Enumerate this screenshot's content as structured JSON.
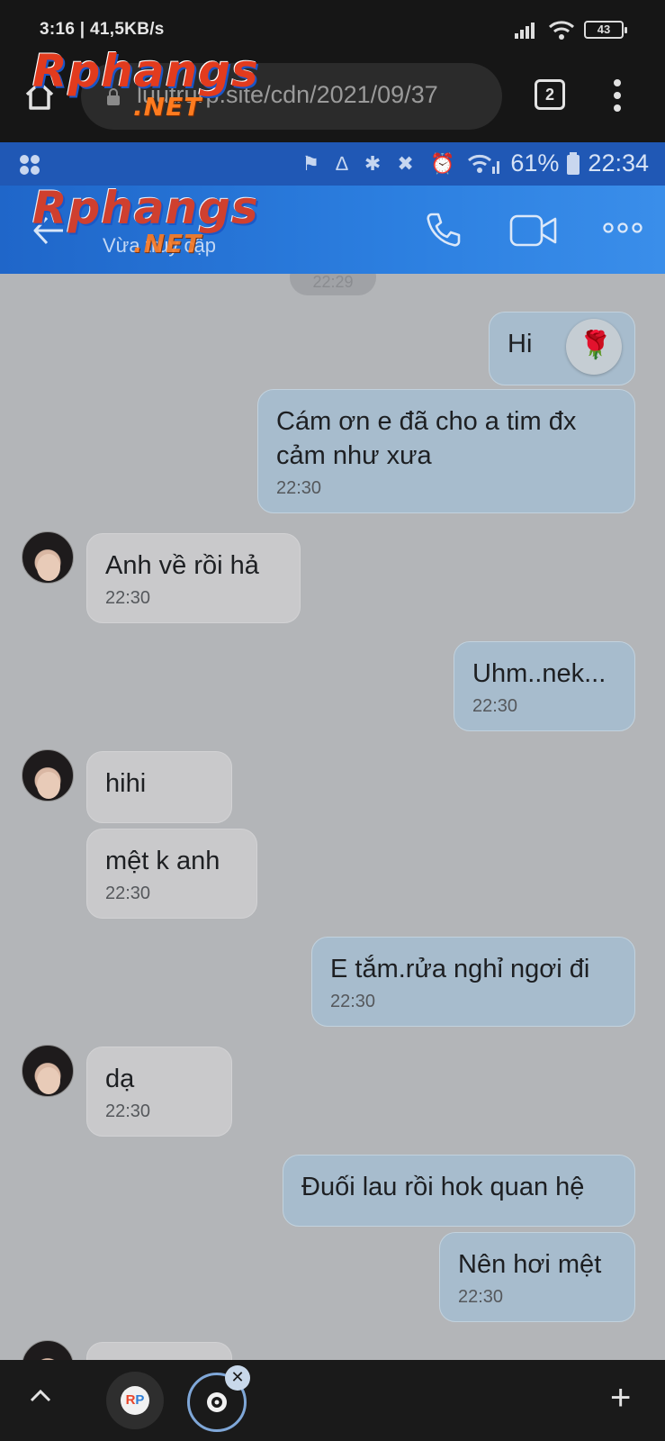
{
  "outer_status": {
    "time": "3:16 | 41,5KB/s",
    "battery": "43"
  },
  "browser": {
    "url": "luutrurp.site/cdn/2021/09/37",
    "tab_count": "2"
  },
  "watermark": {
    "main": "Rphangs",
    "suffix": ".NET"
  },
  "inner_status": {
    "dim_icons": "⚑ ∆ ✱ ✖ ⏰",
    "battery_percent": "61%",
    "time": "22:34"
  },
  "chat_header": {
    "status": "Vừa truy cập"
  },
  "chat": {
    "date_pill": "22:29",
    "messages": [
      {
        "side": "out",
        "text": "Hi",
        "time": ""
      },
      {
        "side": "out",
        "text": "Cám ơn e đã cho a tim đx cảm như xưa",
        "time": "22:30"
      },
      {
        "side": "in",
        "text": "Anh về rồi hả",
        "time": "22:30"
      },
      {
        "side": "out",
        "text": "Uhm..nek...",
        "time": "22:30"
      },
      {
        "side": "in",
        "text": "hihi",
        "time": ""
      },
      {
        "side": "in",
        "text": "mệt k anh",
        "time": "22:30"
      },
      {
        "side": "out",
        "text": "E tắm.rửa nghỉ ngơi đi",
        "time": "22:30"
      },
      {
        "side": "in",
        "text": "dạ",
        "time": "22:30"
      },
      {
        "side": "out",
        "text": "Đuối lau rồi hok quan hệ",
        "time": ""
      },
      {
        "side": "out",
        "text": "Nên hơi mệt",
        "time": "22:30"
      }
    ],
    "reaction_emoji": "🌹"
  },
  "bottom_bar": {
    "rp_r": "R",
    "rp_p": "P",
    "close_glyph": "✕",
    "plus_glyph": "+"
  },
  "colors": {
    "header_blue": "#2c7fe0",
    "status_blue": "#2058b5",
    "out_bubble": "#a7bccd",
    "in_bubble": "#c9c9cb",
    "chat_bg": "#b3b5b8"
  }
}
